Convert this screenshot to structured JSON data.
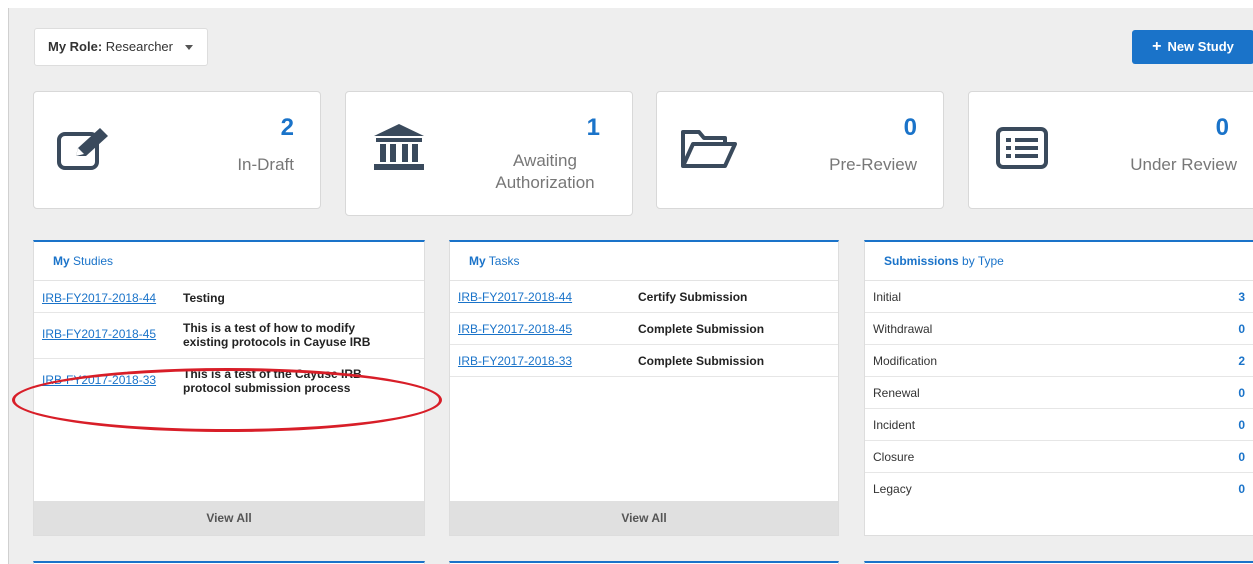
{
  "role": {
    "label": "My Role:",
    "value": "Researcher"
  },
  "new_study": {
    "label": "New Study"
  },
  "stats": [
    {
      "count": "2",
      "label": "In-Draft",
      "icon": "edit-icon"
    },
    {
      "count": "1",
      "label": "Awaiting Authorization",
      "icon": "institution-icon"
    },
    {
      "count": "0",
      "label": "Pre-Review",
      "icon": "folder-open-icon"
    },
    {
      "count": "0",
      "label": "Under Review",
      "icon": "list-alt-icon"
    }
  ],
  "my_studies": {
    "title_bold": "My",
    "title_rest": " Studies",
    "rows": [
      {
        "id": "IRB-FY2017-2018-44",
        "title": "Testing"
      },
      {
        "id": "IRB-FY2017-2018-45",
        "title": "This is a test of how to modify existing protocols in Cayuse IRB"
      },
      {
        "id": "IRB-FY2017-2018-33",
        "title": "This is a test of the Cayuse IRB protocol submission process"
      }
    ],
    "view_all": "View All"
  },
  "my_tasks": {
    "title_bold": "My",
    "title_rest": " Tasks",
    "rows": [
      {
        "id": "IRB-FY2017-2018-44",
        "task": "Certify Submission"
      },
      {
        "id": "IRB-FY2017-2018-45",
        "task": "Complete Submission"
      },
      {
        "id": "IRB-FY2017-2018-33",
        "task": "Complete Submission"
      }
    ],
    "view_all": "View All"
  },
  "submissions": {
    "title_bold": "Submissions",
    "title_rest": " by Type",
    "rows": [
      {
        "type": "Initial",
        "count": "3"
      },
      {
        "type": "Withdrawal",
        "count": "0"
      },
      {
        "type": "Modification",
        "count": "2"
      },
      {
        "type": "Renewal",
        "count": "0"
      },
      {
        "type": "Incident",
        "count": "0"
      },
      {
        "type": "Closure",
        "count": "0"
      },
      {
        "type": "Legacy",
        "count": "0"
      }
    ]
  },
  "colors": {
    "accent": "#1a73c9",
    "annotation": "#d81e28"
  }
}
